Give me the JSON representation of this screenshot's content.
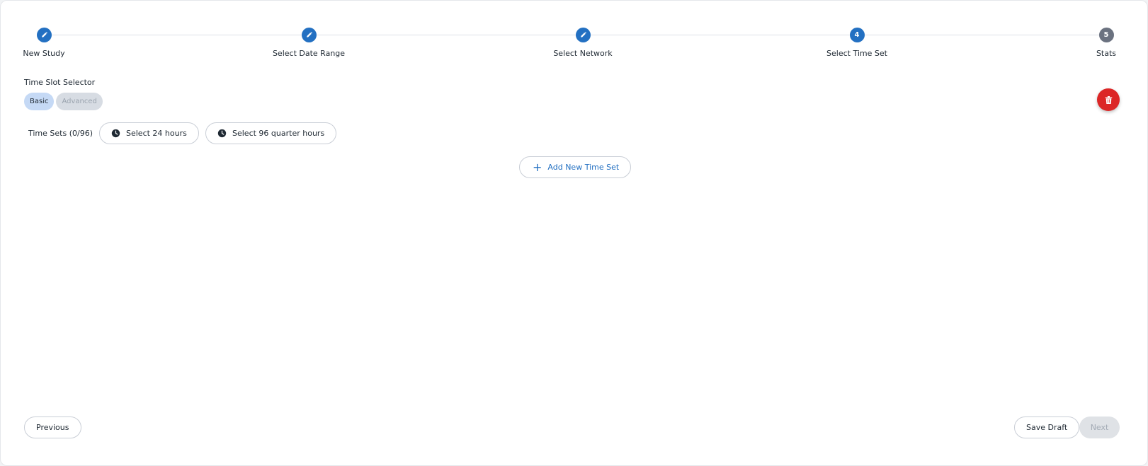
{
  "stepper": {
    "steps": [
      {
        "label": "New Study",
        "state": "completed",
        "icon": "pencil-icon"
      },
      {
        "label": "Select Date Range",
        "state": "completed",
        "icon": "pencil-icon"
      },
      {
        "label": "Select Network",
        "state": "completed",
        "icon": "pencil-icon"
      },
      {
        "label": "Select Time Set",
        "state": "current",
        "number": "4"
      },
      {
        "label": "Stats",
        "state": "pending",
        "number": "5"
      }
    ]
  },
  "time_slot_selector": {
    "title": "Time Slot Selector",
    "modes": [
      {
        "label": "Basic",
        "active": true
      },
      {
        "label": "Advanced",
        "active": false
      }
    ],
    "delete_icon": "trash-icon"
  },
  "time_sets": {
    "label": "Time Sets (0/96)",
    "select_24_label": "Select 24 hours",
    "select_96_label": "Select 96 quarter hours",
    "button_icon": "clock-icon",
    "add_label": "Add New Time Set"
  },
  "footer": {
    "previous_label": "Previous",
    "save_draft_label": "Save Draft",
    "next_label": "Next"
  },
  "colors": {
    "primary": "#2370c2",
    "danger": "#dc2626",
    "pending_step": "#6b7280",
    "active_toggle": "#c5d9f5",
    "disabled_button": "#dfe2e6"
  }
}
